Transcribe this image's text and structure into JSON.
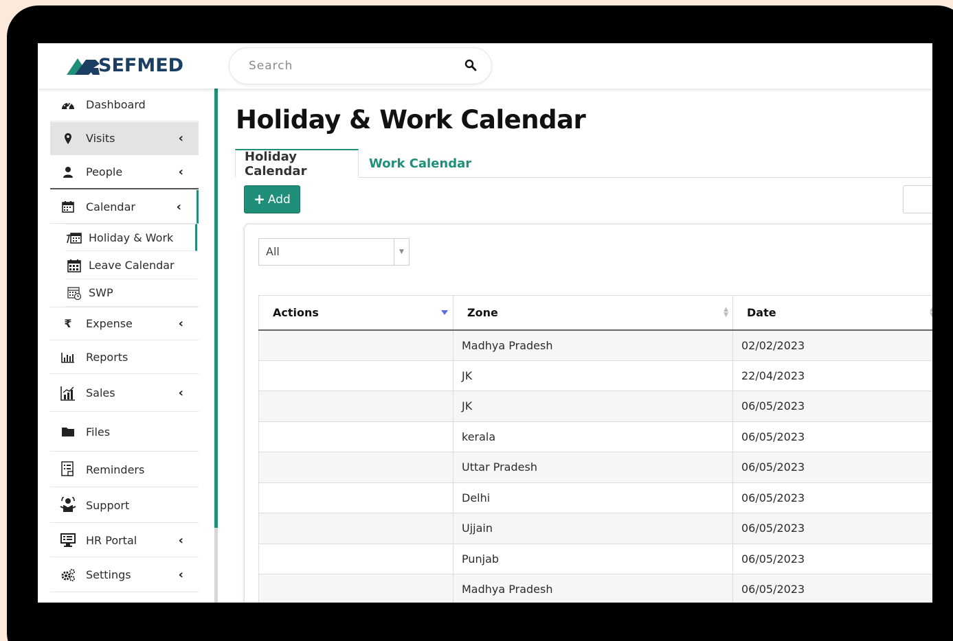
{
  "brand": {
    "name": "SEFMED"
  },
  "search": {
    "placeholder": "Search"
  },
  "sidebar": {
    "items": [
      {
        "label": "Dashboard",
        "icon": "dashboard-icon"
      },
      {
        "label": "Visits",
        "icon": "map-marker-icon",
        "has_submenu": true
      },
      {
        "label": "People",
        "icon": "user-icon",
        "has_submenu": true
      },
      {
        "label": "Calendar",
        "icon": "calendar-icon",
        "has_submenu": true
      },
      {
        "label": "Expense",
        "icon": "rupee-icon",
        "has_submenu": true
      },
      {
        "label": "Reports",
        "icon": "bar-chart-icon"
      },
      {
        "label": "Sales",
        "icon": "sales-chart-icon",
        "has_submenu": true
      },
      {
        "label": "Files",
        "icon": "folder-icon"
      },
      {
        "label": "Reminders",
        "icon": "reminder-icon"
      },
      {
        "label": "Support",
        "icon": "support-icon"
      },
      {
        "label": "HR Portal",
        "icon": "monitor-icon",
        "has_submenu": true
      },
      {
        "label": "Settings",
        "icon": "gears-icon",
        "has_submenu": true
      }
    ],
    "calendar_sub": [
      {
        "label": "Holiday & Work",
        "icon": "holiday-calendar-icon"
      },
      {
        "label": "Leave Calendar",
        "icon": "leave-calendar-icon"
      },
      {
        "label": "SWP",
        "icon": "swp-calendar-icon"
      }
    ]
  },
  "main": {
    "title": "Holiday & Work Calendar",
    "tabs": [
      {
        "label": "Holiday Calendar"
      },
      {
        "label": "Work Calendar"
      }
    ],
    "add_label": "Add",
    "filter": {
      "selected": "All"
    },
    "table": {
      "headers": [
        "Actions",
        "Zone",
        "Date"
      ],
      "rows": [
        {
          "actions": "",
          "zone": "Madhya Pradesh",
          "date": "02/02/2023"
        },
        {
          "actions": "",
          "zone": "JK",
          "date": "22/04/2023"
        },
        {
          "actions": "",
          "zone": "JK",
          "date": "06/05/2023"
        },
        {
          "actions": "",
          "zone": "kerala",
          "date": "06/05/2023"
        },
        {
          "actions": "",
          "zone": "Uttar Pradesh",
          "date": "06/05/2023"
        },
        {
          "actions": "",
          "zone": "Delhi",
          "date": "06/05/2023"
        },
        {
          "actions": "",
          "zone": "Ujjain",
          "date": "06/05/2023"
        },
        {
          "actions": "",
          "zone": "Punjab",
          "date": "06/05/2023"
        },
        {
          "actions": "",
          "zone": "Madhya Pradesh",
          "date": "06/05/2023"
        }
      ]
    }
  },
  "colors": {
    "accent": "#1f8f79",
    "brand_navy": "#1a3f63",
    "frame": "#000000",
    "background": "#fbe9dc"
  }
}
